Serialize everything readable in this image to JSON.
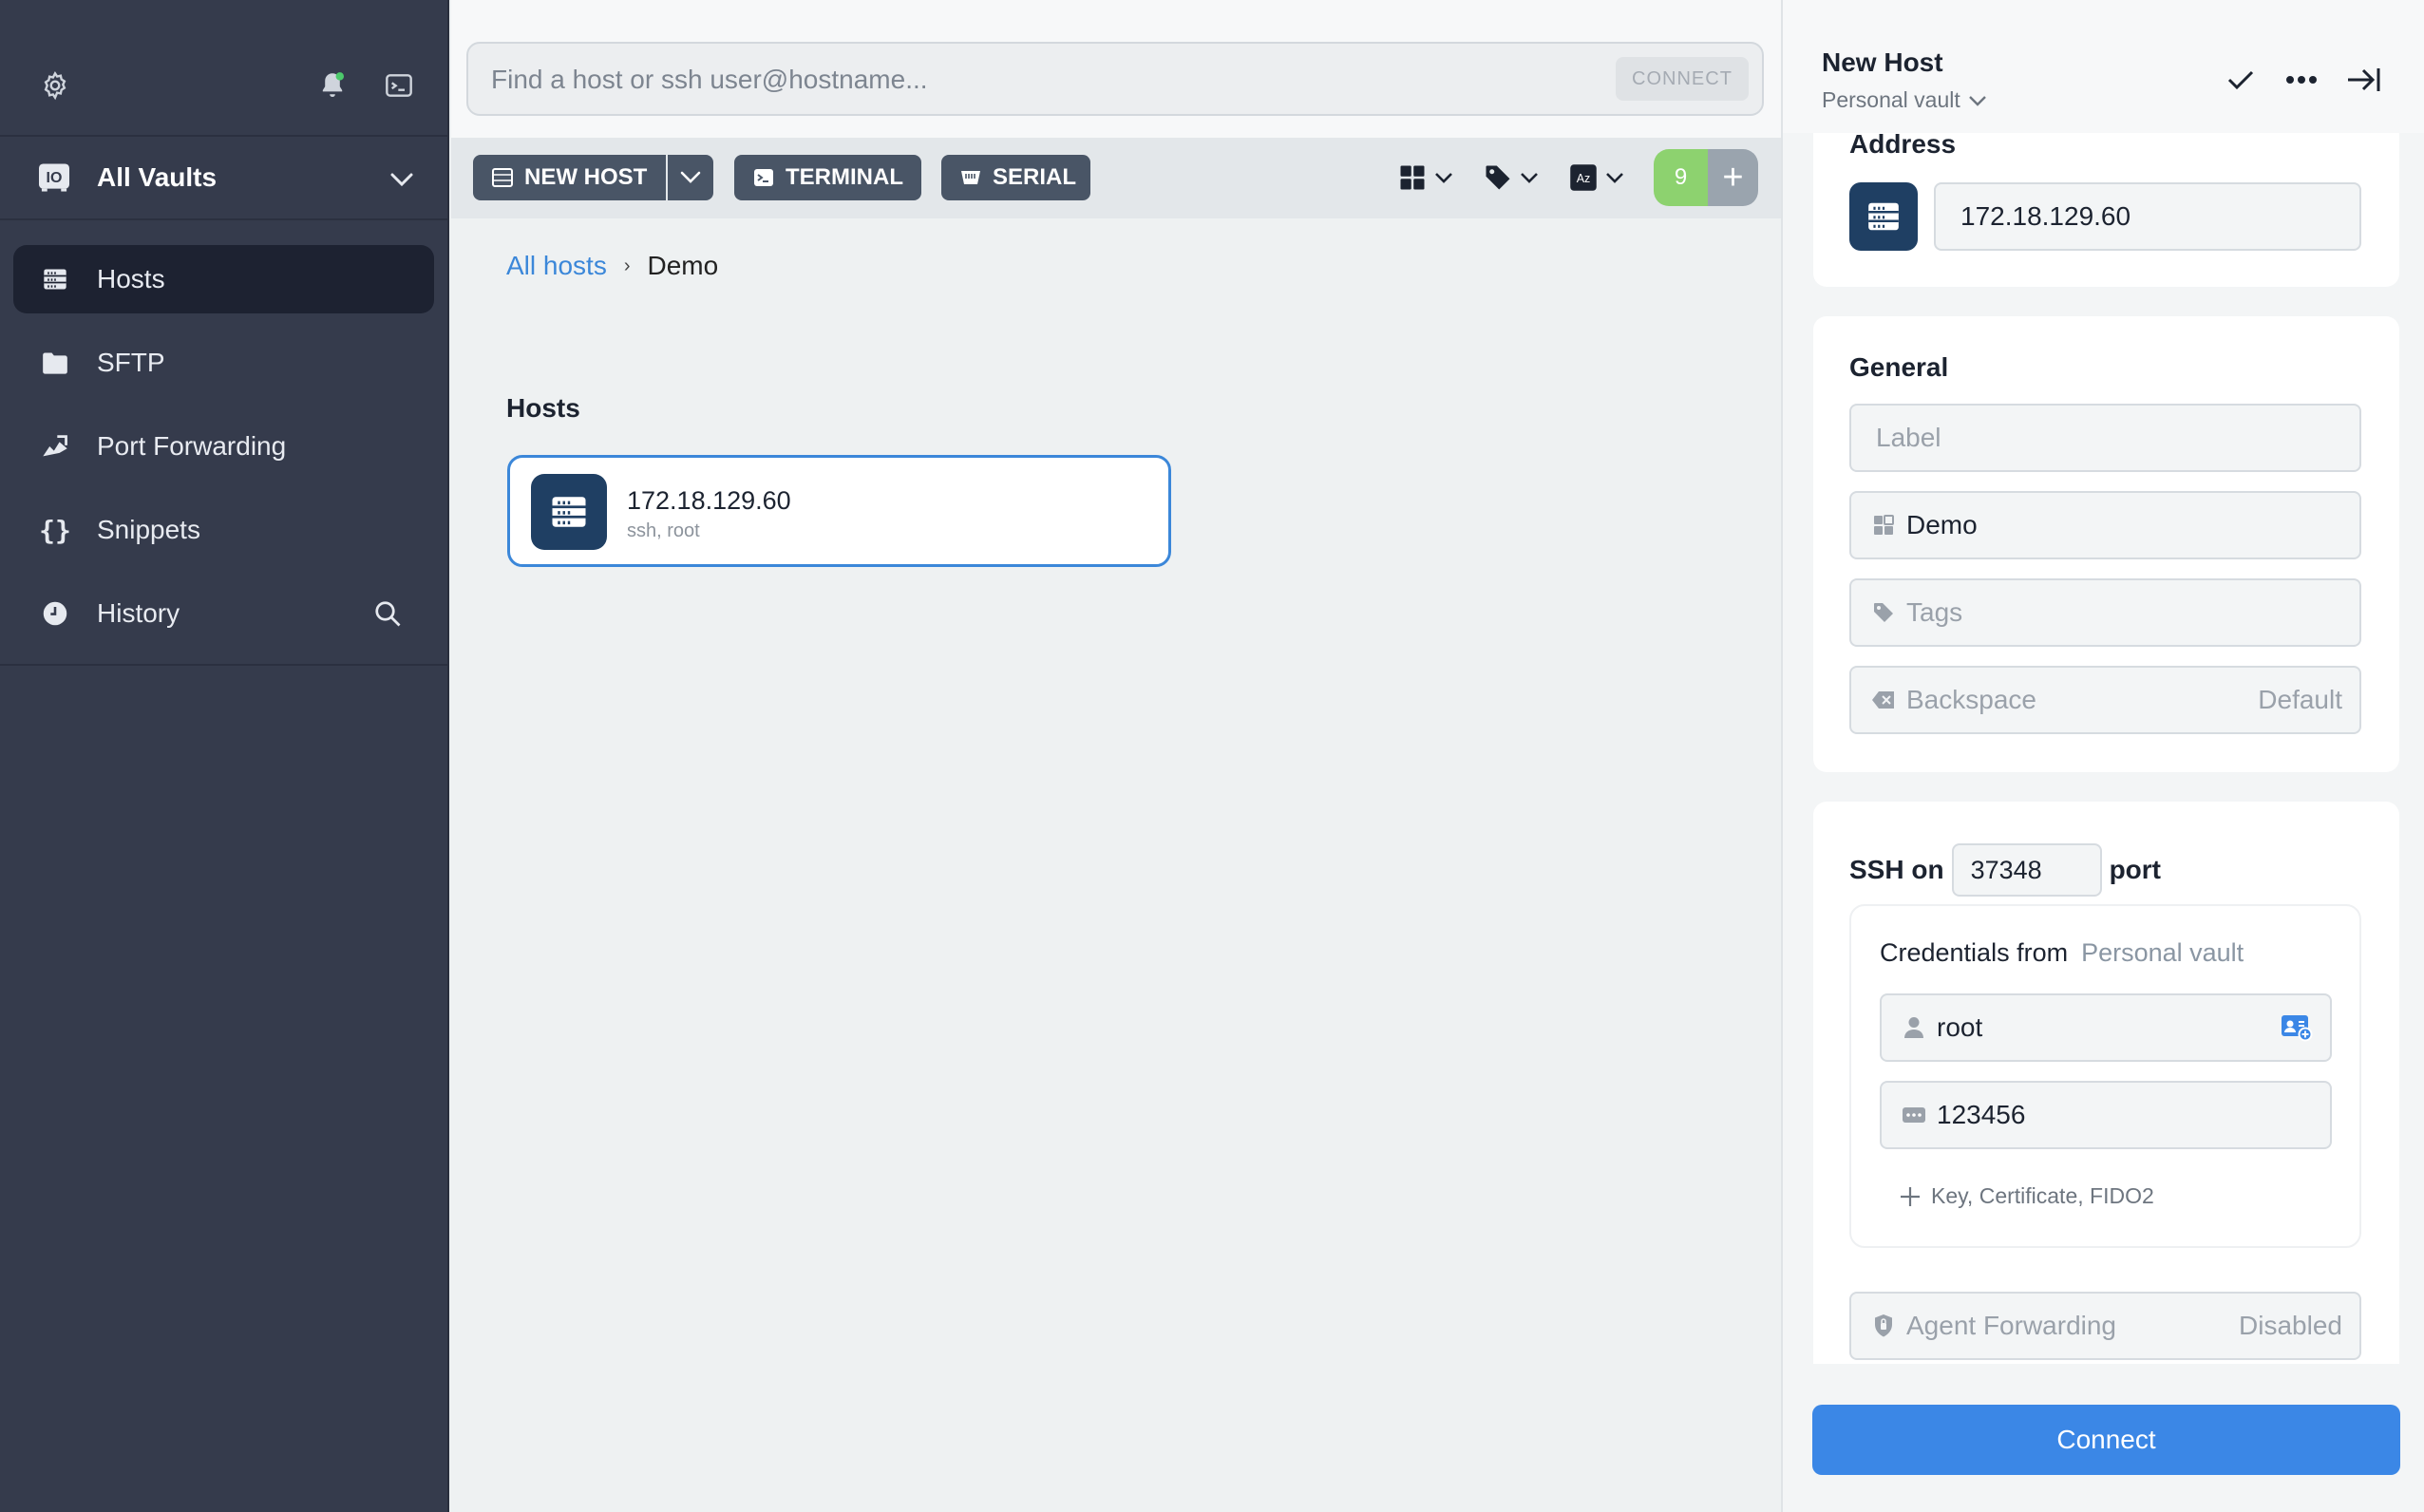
{
  "sidebar": {
    "vault_label": "All Vaults",
    "items": [
      {
        "label": "Hosts"
      },
      {
        "label": "SFTP"
      },
      {
        "label": "Port Forwarding"
      },
      {
        "label": "Snippets"
      },
      {
        "label": "History"
      }
    ]
  },
  "search": {
    "placeholder": "Find a host or ssh user@hostname...",
    "connect_label": "CONNECT"
  },
  "toolbar": {
    "new_host": "NEW HOST",
    "terminal": "TERMINAL",
    "serial": "SERIAL",
    "badge_count": "9",
    "add_symbol": "+"
  },
  "breadcrumb": {
    "root": "All hosts",
    "separator": "›",
    "current": "Demo"
  },
  "hosts_section": {
    "title": "Hosts",
    "hosts": [
      {
        "address": "172.18.129.60",
        "meta": "ssh, root"
      }
    ]
  },
  "panel": {
    "title": "New Host",
    "vault": "Personal vault",
    "address_label": "Address",
    "address_value": "172.18.129.60",
    "general_title": "General",
    "label_placeholder": "Label",
    "group_value": "Demo",
    "tags_placeholder": "Tags",
    "backspace_label": "Backspace",
    "backspace_value": "Default",
    "ssh_on": "SSH on",
    "port_value": "37348",
    "port_label": "port",
    "credentials_from": "Credentials from",
    "credentials_vault": "Personal vault",
    "username": "root",
    "password": "123456",
    "add_key": "Key, Certificate, FIDO2",
    "agent_forwarding_label": "Agent Forwarding",
    "agent_forwarding_value": "Disabled",
    "connect_label": "Connect"
  },
  "colors": {
    "sidebar_bg": "#353b4c",
    "accent": "#3b87e6",
    "host_icon_bg": "#1f3f63",
    "badge_green": "#8dd26f",
    "notification_dot": "#4cc96b"
  }
}
